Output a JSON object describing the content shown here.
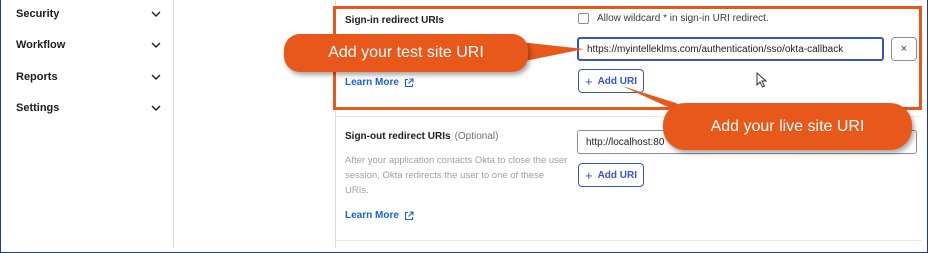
{
  "sidebar": {
    "items": [
      {
        "label": "Security"
      },
      {
        "label": "Workflow"
      },
      {
        "label": "Reports"
      },
      {
        "label": "Settings"
      }
    ]
  },
  "signin": {
    "label": "Sign-in redirect URIs",
    "wildcard_label": "Allow wildcard * in sign-in URI redirect.",
    "uri_value": "https://myintelleklms.com/authentication/sso/okta-callback",
    "remove_label": "×",
    "add_label": "Add URI",
    "learn_more": "Learn More"
  },
  "signout": {
    "label": "Sign-out redirect URIs",
    "optional": "(Optional)",
    "help": "After your application contacts Okta to close the user session, Okta redirects the user to one of these URIs.",
    "uri_value": "http://localhost:80",
    "add_label": "Add URI",
    "learn_more": "Learn More"
  },
  "annotations": {
    "test_site": "Add your test site URI",
    "live_site": "Add your live site URI",
    "color": "#e8581a"
  },
  "colors": {
    "accent": "#3654c8",
    "link": "#1662dd"
  }
}
